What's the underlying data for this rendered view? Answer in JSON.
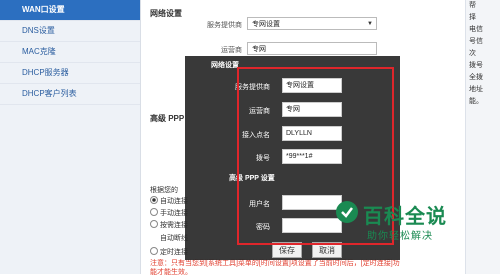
{
  "sidebar": {
    "items": [
      {
        "label": "WAN口设置",
        "active": true
      },
      {
        "label": "DNS设置",
        "active": false
      },
      {
        "label": "MAC克隆",
        "active": false
      },
      {
        "label": "DHCP服务器",
        "active": false
      },
      {
        "label": "DHCP客户列表",
        "active": false
      }
    ]
  },
  "main": {
    "network_section_title": "网络设置",
    "provider_label": "服务提供商",
    "provider_value": "专网设置",
    "operator_label": "运营商",
    "operator_value": "专网",
    "advanced_ppp_title": "高级 PPP",
    "connect_mode_intro": "根据您的",
    "modes": [
      {
        "label": "自动连接",
        "selected": true
      },
      {
        "label": "手动连接",
        "selected": false
      },
      {
        "label": "按需连接",
        "selected": false
      },
      {
        "label": "自动断线",
        "selected": false
      },
      {
        "label": "定时连接",
        "selected": false
      }
    ],
    "note_line1": "注意：只有当您到[系统工具]菜单的[时间设置]项设置了当前时间后，[定时连接]功",
    "note_line2": "能才能生效。"
  },
  "right_panel": {
    "lines": [
      "帮",
      "择",
      "电信",
      "号信",
      "次",
      "拨号",
      "全拨",
      "地址",
      "能。"
    ]
  },
  "dialog": {
    "title": "网络设置",
    "fields": [
      {
        "label": "服务提供商",
        "value": "专网设置"
      },
      {
        "label": "运营商",
        "value": "专网"
      },
      {
        "label": "接入点名",
        "value": "DLYLLN"
      },
      {
        "label": "拨号",
        "value": "*99***1#"
      }
    ],
    "advanced_title": "高级 PPP 设置",
    "auth_fields": [
      {
        "label": "用户名",
        "value": ""
      },
      {
        "label": "密码",
        "value": ""
      }
    ],
    "save_label": "保存",
    "cancel_label": "取消"
  },
  "watermark": {
    "title": "百科全说",
    "subtitle": "助你轻松解决"
  },
  "colors": {
    "accent": "#2c6fc0",
    "highlight_border": "#e0262b",
    "note_red": "#e03c2c",
    "brand_green": "#1a8a52"
  }
}
